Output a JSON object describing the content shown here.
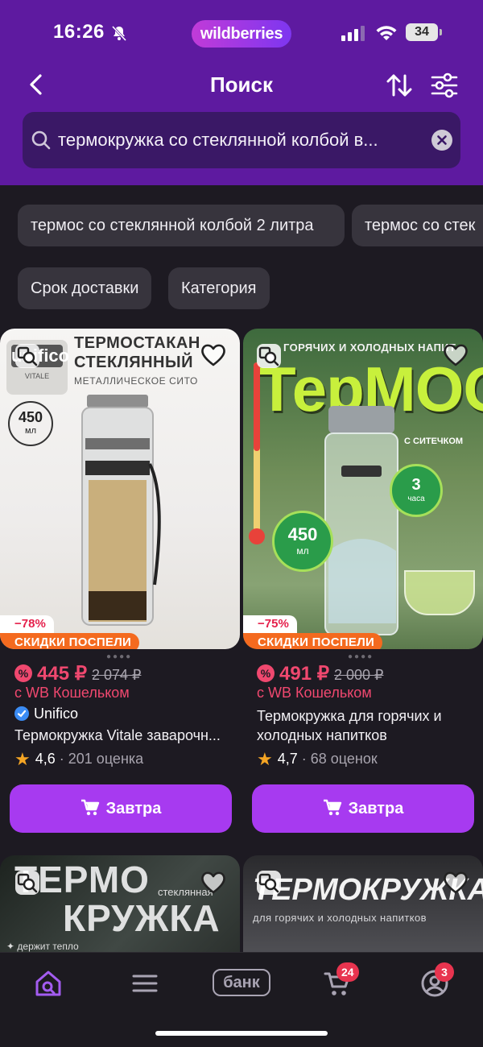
{
  "status_bar": {
    "time": "16:26",
    "brand": "wildberries",
    "battery": "34"
  },
  "header": {
    "title": "Поиск"
  },
  "search": {
    "query": "термокружка со стеклянной колбой в..."
  },
  "suggestions": [
    "термос со стеклянной колбой 2 литра",
    "термос со стек"
  ],
  "filters": [
    "Срок доставки",
    "Категория"
  ],
  "products": [
    {
      "image_title": "ТЕРМОСТАКАН СТЕКЛЯННЫЙ",
      "image_subtitle": "МЕТАЛЛИЧЕСКОЕ СИТО",
      "image_logo": "unifico",
      "image_logo_sub": "VITALE",
      "image_volume": "450",
      "image_volume_unit": "мл",
      "discount": "−78%",
      "sale_label": "СКИДКИ ПОСПЕЛИ",
      "price": "445 ₽",
      "old_price": "2 074 ₽",
      "wallet_note": "с WB Кошельком",
      "brand": "Unifico",
      "name": "Термокружка Vitale заварочн...",
      "rating": "4,6",
      "reviews": "· 201 оценка",
      "buy_label": "Завтра"
    },
    {
      "image_title": "ТерМОС",
      "image_top": "ГОРЯЧИХ И ХОЛОДНЫХ НАПИТ",
      "image_sub": "С СИТЕЧКОМ",
      "image_volume": "450",
      "image_volume_unit": "мл",
      "image_hours": "3",
      "image_hours_unit": "часа",
      "discount": "−75%",
      "sale_label": "СКИДКИ ПОСПЕЛИ",
      "price": "491 ₽",
      "old_price": "2 000 ₽",
      "wallet_note": "с WB Кошельком",
      "name_line1": "Термокружка для горячих и",
      "name_line2": "холодных напитков",
      "rating": "4,7",
      "reviews": "· 68 оценок",
      "buy_label": "Завтра"
    },
    {
      "image_title_line1": "ТЕРМО",
      "image_title_line2": "КРУЖКА",
      "image_tag": "стеклянная",
      "image_note": "✦ держит тепло"
    },
    {
      "image_title": "ТЕРМОКРУЖКА",
      "image_sub": "для горячих и холодных напитков"
    }
  ],
  "tabbar": {
    "bank_label": "банк",
    "cart_count": "24",
    "profile_count": "3"
  },
  "colors": {
    "brand_purple": "#5e1aa0",
    "accent": "#a73af0",
    "price_pink": "#f0486f",
    "sale_orange": "#f46a1f"
  }
}
